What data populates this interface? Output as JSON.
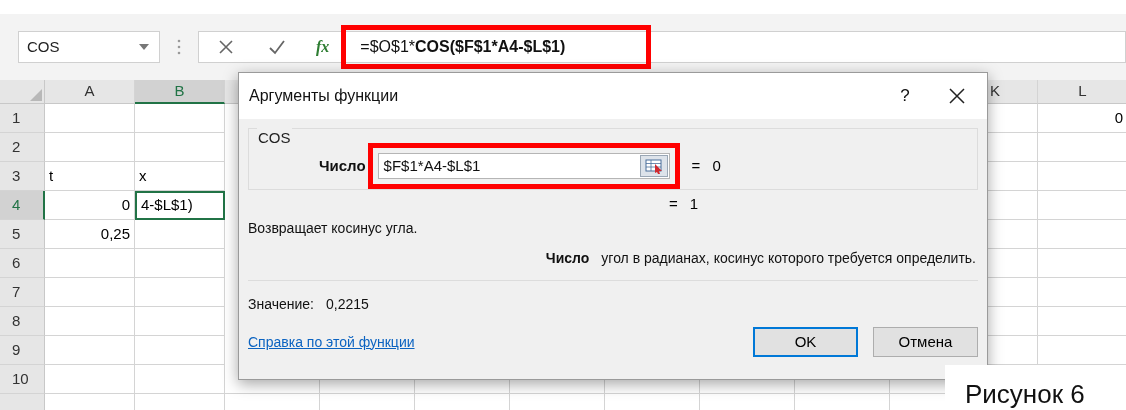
{
  "formula_bar": {
    "name_box": "COS",
    "fx": "fx",
    "highlighted": true,
    "formula": [
      {
        "text": "=$O$1*",
        "bold": false
      },
      {
        "text": "COS($F$1*A4-$L$1)",
        "bold": true
      }
    ]
  },
  "sheet": {
    "columns": [
      {
        "label": "A",
        "selected": false
      },
      {
        "label": "B",
        "selected": true
      },
      {
        "label": "K",
        "selected": false
      },
      {
        "label": "L",
        "selected": false
      }
    ],
    "rows": [
      {
        "label": "1",
        "selected": false,
        "l": {
          "text": "0",
          "kind": "number"
        }
      },
      {
        "label": "2",
        "selected": false
      },
      {
        "label": "3",
        "selected": false,
        "a": {
          "text": "t",
          "kind": "text"
        },
        "b": {
          "text": "x",
          "kind": "text"
        }
      },
      {
        "label": "4",
        "selected": true,
        "a": {
          "text": "0",
          "kind": "number"
        },
        "b": {
          "text": "4-$L$1)",
          "kind": "text",
          "active": true
        }
      },
      {
        "label": "5",
        "selected": false,
        "a": {
          "text": "0,25",
          "kind": "number"
        }
      },
      {
        "label": "6",
        "selected": false
      },
      {
        "label": "7",
        "selected": false
      },
      {
        "label": "8",
        "selected": false
      },
      {
        "label": "9",
        "selected": false
      },
      {
        "label": "10",
        "selected": false
      }
    ]
  },
  "dialog": {
    "title": "Аргументы функции",
    "help": "?",
    "function": "COS",
    "argument": {
      "label": "Число",
      "value": "$F$1*A4-$L$1",
      "highlighted": true,
      "equals": "=",
      "result": "0"
    },
    "result_equals": "=",
    "result": "1",
    "description": "Возвращает косинус угла.",
    "argument_help": {
      "label": "Число",
      "text": "угол в радианах, косинус которого требуется определить."
    },
    "value_label": "Значение:",
    "value": "0,2215",
    "help_link": "Справка по этой функции",
    "buttons": [
      {
        "label": "OK",
        "default": true
      },
      {
        "label": "Отмена",
        "default": false
      }
    ]
  },
  "caption": "Рисунок 6"
}
